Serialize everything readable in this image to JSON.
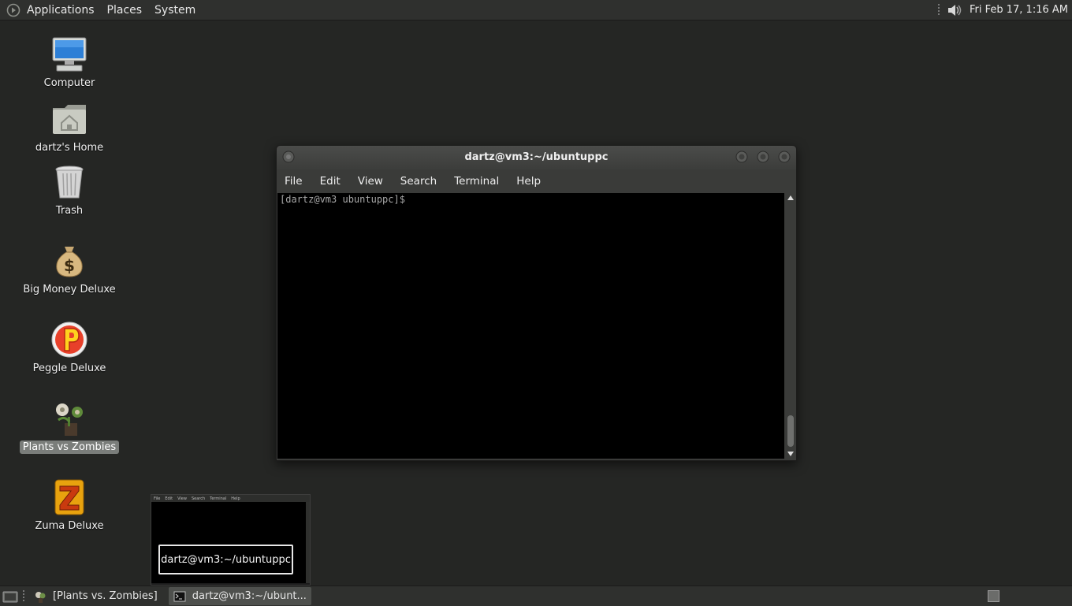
{
  "top_panel": {
    "menus": [
      "Applications",
      "Places",
      "System"
    ],
    "clock": "Fri Feb 17,  1:16 AM",
    "icons": [
      "ubuntu-logo-icon",
      "volume-icon"
    ]
  },
  "desktop": {
    "icons": [
      {
        "label": "Computer",
        "icon": "computer-icon"
      },
      {
        "label": "dartz's Home",
        "icon": "home-folder-icon"
      },
      {
        "label": "Trash",
        "icon": "trash-icon"
      },
      {
        "label": "Big Money Deluxe",
        "icon": "money-bag-icon"
      },
      {
        "label": "Peggle Deluxe",
        "icon": "peggle-icon"
      },
      {
        "label": "Plants vs Zombies",
        "icon": "plants-vs-zombies-icon",
        "selected": true
      },
      {
        "label": "Zuma Deluxe",
        "icon": "zuma-icon"
      }
    ]
  },
  "terminal": {
    "title": "dartz@vm3:~/ubuntuppc",
    "menu": [
      "File",
      "Edit",
      "View",
      "Search",
      "Terminal",
      "Help"
    ],
    "prompt": "[dartz@vm3 ubuntuppc]$ "
  },
  "preview": {
    "caption": "dartz@vm3:~/ubuntuppc",
    "mini_menu": [
      "File",
      "Edit",
      "View",
      "Search",
      "Terminal",
      "Help"
    ]
  },
  "taskbar": {
    "tasks": [
      {
        "label": "[Plants vs. Zombies]",
        "icon": "pvz-task-icon",
        "active": false
      },
      {
        "label": "dartz@vm3:~/ubunt...",
        "icon": "terminal-icon",
        "active": true
      }
    ]
  },
  "colors": {
    "desktop_bg": "#252624",
    "panel_bg": "#2f302e",
    "terminal_bg": "#000000"
  }
}
